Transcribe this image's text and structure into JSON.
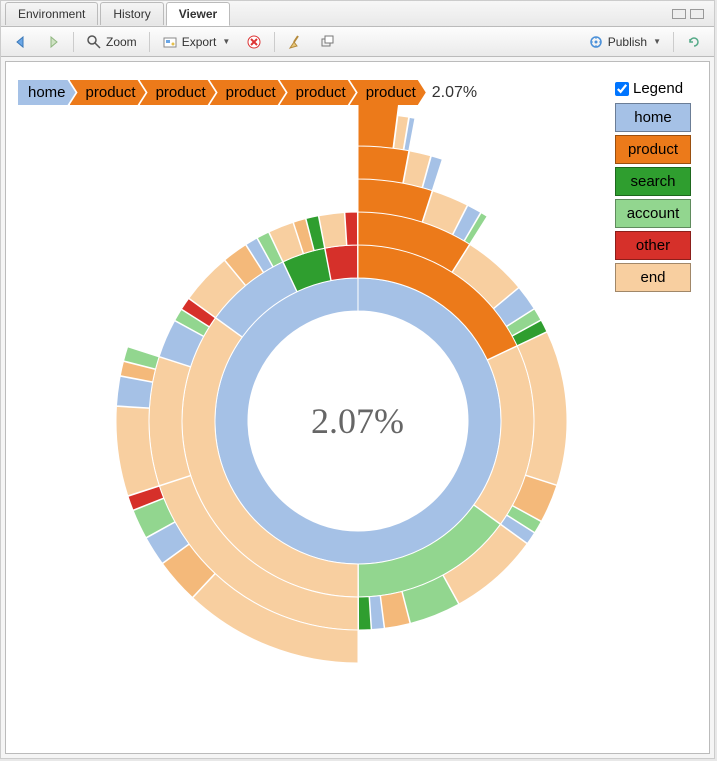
{
  "tabs": {
    "items": [
      "Environment",
      "History",
      "Viewer"
    ],
    "active_index": 2
  },
  "toolbar": {
    "back_tooltip": "Back",
    "forward_tooltip": "Forward",
    "zoom_label": "Zoom",
    "export_label": "Export",
    "remove_tooltip": "Remove",
    "broom_tooltip": "Clear",
    "popout_tooltip": "Show in new window",
    "publish_label": "Publish",
    "refresh_tooltip": "Refresh"
  },
  "breadcrumb": {
    "items": [
      {
        "label": "home",
        "color": "#a5c1e6"
      },
      {
        "label": "product",
        "color": "#ec7a1a"
      },
      {
        "label": "product",
        "color": "#ec7a1a"
      },
      {
        "label": "product",
        "color": "#ec7a1a"
      },
      {
        "label": "product",
        "color": "#ec7a1a"
      },
      {
        "label": "product",
        "color": "#ec7a1a"
      }
    ],
    "value": "2.07%"
  },
  "legend": {
    "checkbox_label": "Legend",
    "checked": true,
    "items": [
      {
        "label": "home",
        "color": "#a5c1e6"
      },
      {
        "label": "product",
        "color": "#ec7a1a"
      },
      {
        "label": "search",
        "color": "#2f9e2f"
      },
      {
        "label": "account",
        "color": "#92d68f"
      },
      {
        "label": "other",
        "color": "#d6302a"
      },
      {
        "label": "end",
        "color": "#f8cfa0"
      }
    ]
  },
  "center_value": "2.07%",
  "chart_data": {
    "type": "sunburst",
    "title": "",
    "value_format": "percent_of_root",
    "selected_path": [
      "home",
      "product",
      "product",
      "product",
      "product",
      "product"
    ],
    "selected_value_pct": 2.07,
    "categories": [
      "home",
      "product",
      "search",
      "account",
      "other",
      "end"
    ],
    "category_colors": {
      "home": "#a5c1e6",
      "product": "#ec7a1a",
      "search": "#2f9e2f",
      "account": "#92d68f",
      "other": "#d6302a",
      "end": "#f8cfa0"
    },
    "root": {
      "name": "home",
      "pct": 100,
      "children": [
        {
          "name": "product",
          "pct": 18,
          "children": [
            {
              "name": "product",
              "pct": 9,
              "children": [
                {
                  "name": "product",
                  "pct": 5,
                  "children": [
                    {
                      "name": "product",
                      "pct": 3,
                      "children": [
                        {
                          "name": "product",
                          "pct": 2.07
                        },
                        {
                          "name": "end",
                          "pct": 0.6
                        },
                        {
                          "name": "home",
                          "pct": 0.33
                        }
                      ]
                    },
                    {
                      "name": "end",
                      "pct": 1.3
                    },
                    {
                      "name": "home",
                      "pct": 0.7
                    }
                  ]
                },
                {
                  "name": "end",
                  "pct": 2.5
                },
                {
                  "name": "home",
                  "pct": 1.0
                },
                {
                  "name": "account",
                  "pct": 0.5
                }
              ]
            },
            {
              "name": "end",
              "pct": 5
            },
            {
              "name": "home",
              "pct": 2
            },
            {
              "name": "account",
              "pct": 1
            },
            {
              "name": "search",
              "pct": 1
            }
          ]
        },
        {
          "name": "end",
          "pct": 17,
          "children": [
            {
              "name": "end",
              "pct": 12
            },
            {
              "name": "product",
              "pct": 3
            },
            {
              "name": "account",
              "pct": 1
            },
            {
              "name": "home",
              "pct": 1
            }
          ]
        },
        {
          "name": "account",
          "pct": 15,
          "children": [
            {
              "name": "end",
              "pct": 7
            },
            {
              "name": "account",
              "pct": 4
            },
            {
              "name": "product",
              "pct": 2
            },
            {
              "name": "home",
              "pct": 1
            },
            {
              "name": "search",
              "pct": 1
            }
          ]
        },
        {
          "name": "end",
          "pct": 35,
          "children": [
            {
              "name": "end",
              "pct": 20,
              "children": [
                {
                  "name": "end",
                  "pct": 12
                },
                {
                  "name": "product",
                  "pct": 3
                },
                {
                  "name": "home",
                  "pct": 2
                },
                {
                  "name": "account",
                  "pct": 2
                },
                {
                  "name": "other",
                  "pct": 1
                }
              ]
            },
            {
              "name": "end",
              "pct": 10,
              "children": [
                {
                  "name": "end",
                  "pct": 6
                },
                {
                  "name": "home",
                  "pct": 2
                },
                {
                  "name": "product",
                  "pct": 1
                },
                {
                  "name": "account",
                  "pct": 1
                }
              ]
            },
            {
              "name": "home",
              "pct": 3
            },
            {
              "name": "account",
              "pct": 1
            },
            {
              "name": "other",
              "pct": 1
            }
          ]
        },
        {
          "name": "home",
          "pct": 8,
          "children": [
            {
              "name": "end",
              "pct": 4
            },
            {
              "name": "product",
              "pct": 2
            },
            {
              "name": "home",
              "pct": 1
            },
            {
              "name": "account",
              "pct": 1
            }
          ]
        },
        {
          "name": "search",
          "pct": 4,
          "children": [
            {
              "name": "end",
              "pct": 2
            },
            {
              "name": "product",
              "pct": 1
            },
            {
              "name": "search",
              "pct": 1
            }
          ]
        },
        {
          "name": "other",
          "pct": 3,
          "children": [
            {
              "name": "end",
              "pct": 2
            },
            {
              "name": "other",
              "pct": 1
            }
          ]
        }
      ]
    }
  }
}
